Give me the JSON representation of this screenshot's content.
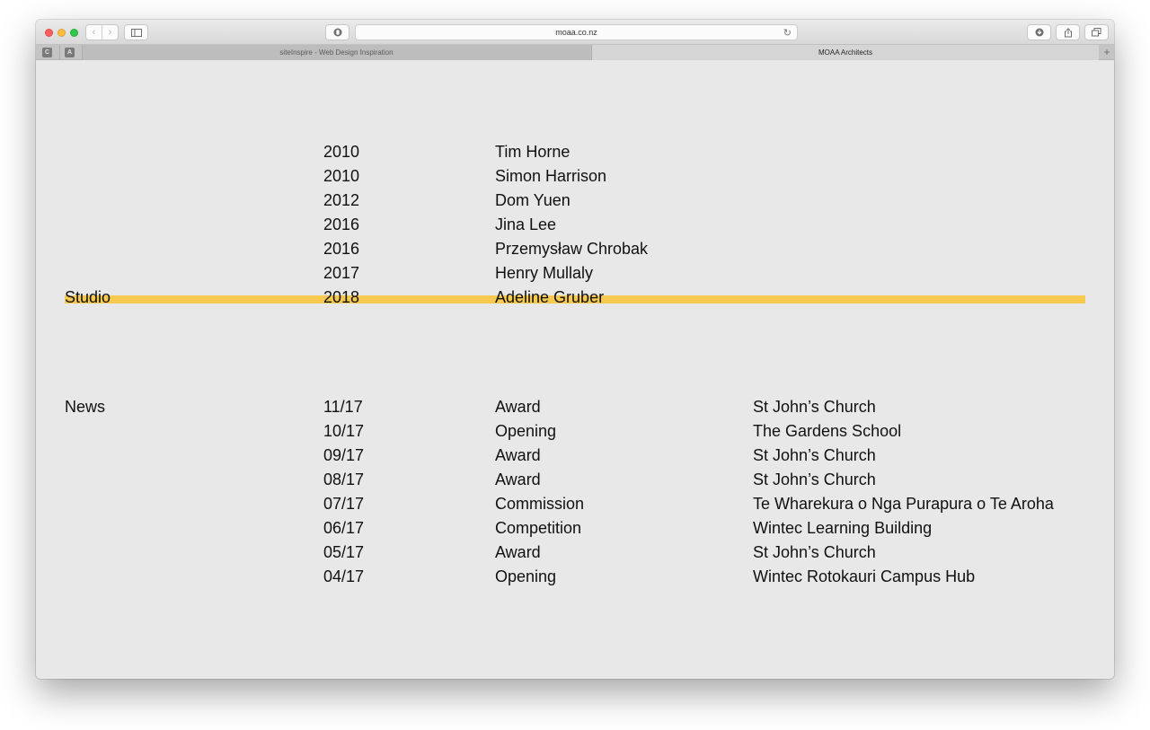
{
  "browser": {
    "address": "moaa.co.nz",
    "tabs": [
      {
        "label": "siteInspire - Web Design Inspiration",
        "active": false
      },
      {
        "label": "MOAA Architects",
        "active": true
      }
    ],
    "pinned": [
      "C",
      "A"
    ],
    "new_tab": "+"
  },
  "studio": {
    "label": "Studio",
    "highlight_color": "#f7c94f",
    "people": [
      {
        "year": "2010",
        "name": "Tim Horne"
      },
      {
        "year": "2010",
        "name": "Simon Harrison"
      },
      {
        "year": "2012",
        "name": "Dom Yuen"
      },
      {
        "year": "2016",
        "name": "Jina Lee"
      },
      {
        "year": "2016",
        "name": "Przemysław Chrobak"
      },
      {
        "year": "2017",
        "name": "Henry Mullaly"
      },
      {
        "year": "2018",
        "name": "Adeline Gruber"
      }
    ]
  },
  "news": {
    "label": "News",
    "items": [
      {
        "date": "11/17",
        "type": "Award",
        "project": "St John’s Church"
      },
      {
        "date": "10/17",
        "type": "Opening",
        "project": "The Gardens School"
      },
      {
        "date": "09/17",
        "type": "Award",
        "project": "St John’s Church"
      },
      {
        "date": "08/17",
        "type": "Award",
        "project": "St John’s Church"
      },
      {
        "date": "07/17",
        "type": "Commission",
        "project": "Te Wharekura o Nga Purapura o Te Aroha"
      },
      {
        "date": "06/17",
        "type": "Competition",
        "project": "Wintec Learning Building"
      },
      {
        "date": "05/17",
        "type": "Award",
        "project": "St John’s Church"
      },
      {
        "date": "04/17",
        "type": "Opening",
        "project": "Wintec Rotokauri Campus Hub"
      }
    ]
  }
}
